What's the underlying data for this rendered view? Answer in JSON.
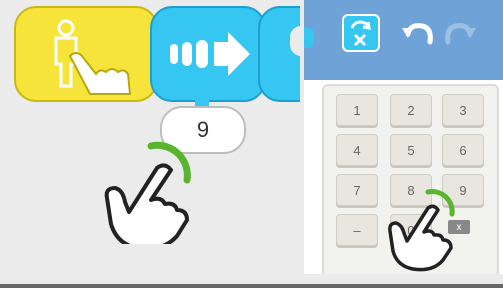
{
  "value_bubble": {
    "value": "9"
  },
  "keypad": {
    "keys": [
      "1",
      "2",
      "3",
      "4",
      "5",
      "6",
      "7",
      "8",
      "9",
      "–",
      "0"
    ],
    "backspace": "x"
  },
  "colors": {
    "block_yellow": "#f7e43a",
    "block_cyan": "#35c6f2",
    "toolbar_blue": "#6fa2d6",
    "tap_green": "#5ab52e"
  },
  "icons": [
    "touch-start-icon",
    "move-forward-icon",
    "erase-block-icon",
    "undo-icon",
    "redo-icon",
    "pointing-hand-icon",
    "backspace-icon"
  ]
}
